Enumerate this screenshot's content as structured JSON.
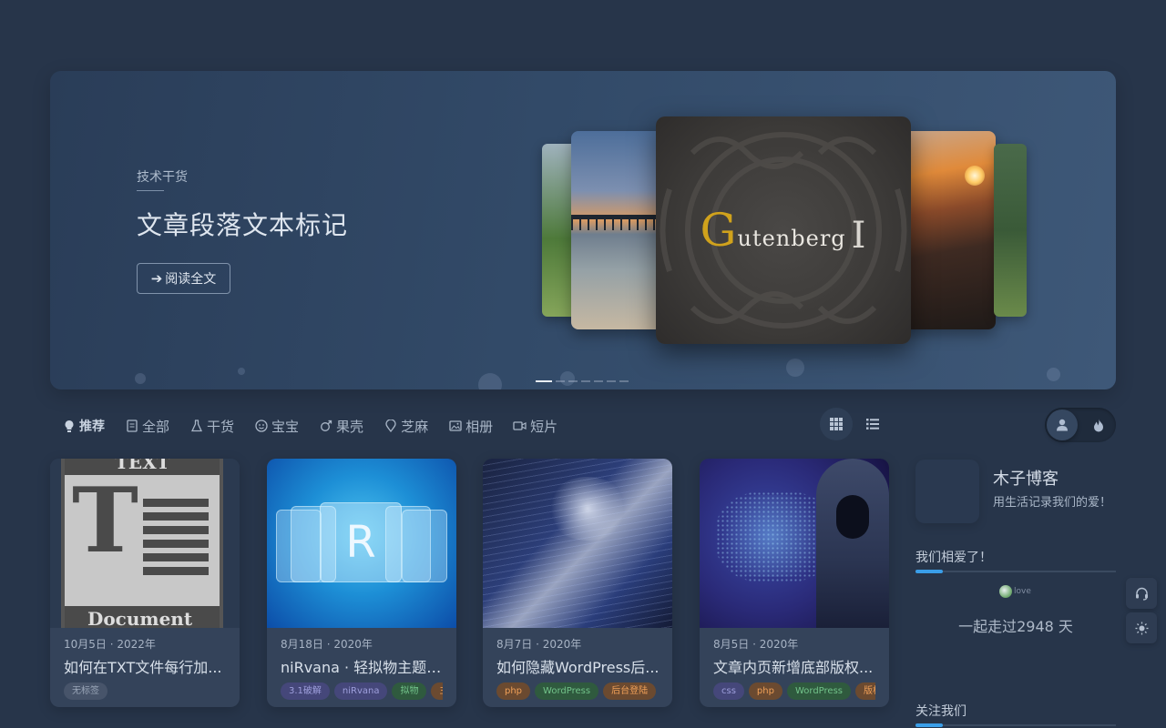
{
  "hero": {
    "category": "技术干货",
    "title": "文章段落文本标记",
    "read_button": "阅读全文",
    "read_button_icon": "arrow-right-icon",
    "center_slide": {
      "logo_initial": "G",
      "logo_rest": "utenberg",
      "cursor": "I"
    },
    "slides_total": 7,
    "active_slide": 1
  },
  "nav": {
    "items": [
      {
        "label": "推荐",
        "icon": "lightbulb-icon",
        "active": true
      },
      {
        "label": "全部",
        "icon": "document-icon"
      },
      {
        "label": "干货",
        "icon": "flask-icon"
      },
      {
        "label": "宝宝",
        "icon": "baby-face-icon"
      },
      {
        "label": "果壳",
        "icon": "male-symbol-icon"
      },
      {
        "label": "芝麻",
        "icon": "location-pin-icon"
      },
      {
        "label": "相册",
        "icon": "image-icon"
      },
      {
        "label": "短片",
        "icon": "video-icon"
      }
    ],
    "view_modes": [
      "grid-view-icon",
      "list-view-icon"
    ],
    "active_view": "grid"
  },
  "cards": [
    {
      "date": "10月5日 · 2022年",
      "title": "如何在TXT文件每行加...",
      "thumb_text": {
        "top": "TEXT",
        "big": "T",
        "bottom": "Document"
      },
      "tags": [
        {
          "label": "无标签",
          "color": "gray"
        }
      ]
    },
    {
      "date": "8月18日 · 2020年",
      "title": "niRvana · 轻拟物主题 3....",
      "thumb_text": {
        "big": "R"
      },
      "tags": [
        {
          "label": "3.1破解",
          "color": "purple"
        },
        {
          "label": "niRvana",
          "color": "purple"
        },
        {
          "label": "拟物",
          "color": "green"
        },
        {
          "label": "主题",
          "color": "orange"
        }
      ]
    },
    {
      "date": "8月7日 · 2020年",
      "title": "如何隐藏WordPress后...",
      "tags": [
        {
          "label": "php",
          "color": "orange"
        },
        {
          "label": "WordPress",
          "color": "green"
        },
        {
          "label": "后台登陆",
          "color": "orange"
        }
      ]
    },
    {
      "date": "8月5日 · 2020年",
      "title": "文章内页新增底部版权...",
      "tags": [
        {
          "label": "css",
          "color": "purple"
        },
        {
          "label": "php",
          "color": "orange"
        },
        {
          "label": "WordPress",
          "color": "green"
        },
        {
          "label": "版权",
          "color": "orange"
        }
      ]
    }
  ],
  "sidebar": {
    "blog_name": "木子博客",
    "blog_desc": "用生活记录我们的爱！",
    "love_section_title": "我们相爱了！",
    "love_image_alt": "love",
    "days_text": "一起走过2948 天",
    "follow_title": "关注我们"
  },
  "colors": {
    "background": "#27354a",
    "accent": "#3a9ee8",
    "card": "#34435a"
  }
}
